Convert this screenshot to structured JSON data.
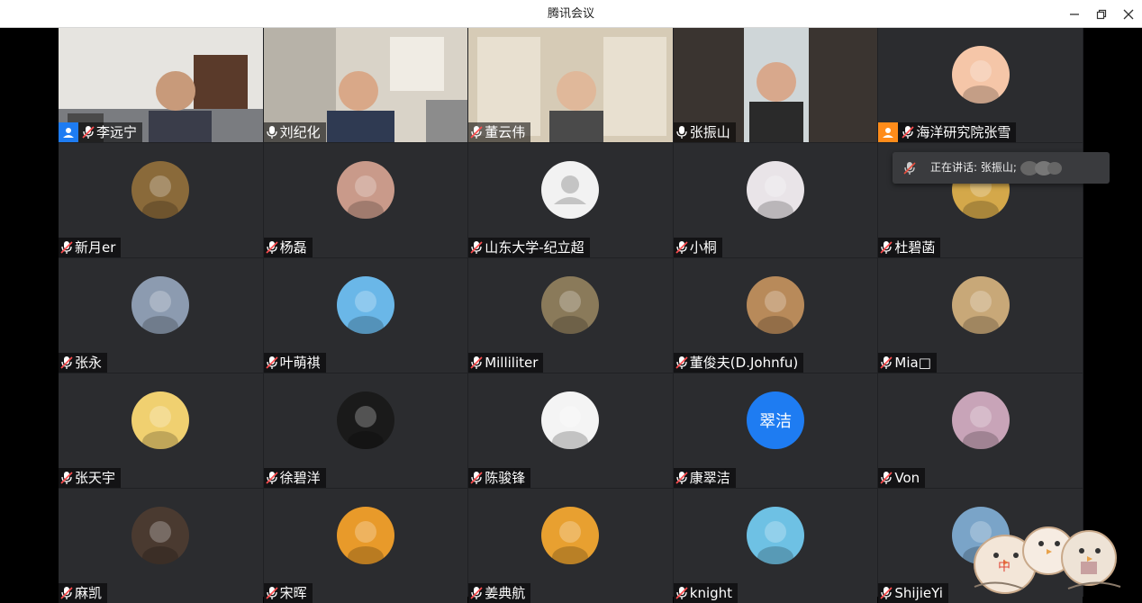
{
  "window": {
    "title": "腾讯会议"
  },
  "participants": [
    {
      "name": "李远宁",
      "mic": "muted",
      "badge": "host",
      "video": true
    },
    {
      "name": "刘纪化",
      "mic": "on",
      "video": true
    },
    {
      "name": "董云伟",
      "mic": "muted",
      "video": true
    },
    {
      "name": "张振山",
      "mic": "on",
      "video": true,
      "speaking": true
    },
    {
      "name": "海洋研究院张雪",
      "mic": "muted",
      "badge": "cohost",
      "video": false
    },
    {
      "name": "新月er",
      "mic": "muted"
    },
    {
      "name": "杨磊",
      "mic": "muted"
    },
    {
      "name": "山东大学-纪立超",
      "mic": "muted",
      "avatar": "default"
    },
    {
      "name": "小桐",
      "mic": "muted"
    },
    {
      "name": "杜碧菡",
      "mic": "muted"
    },
    {
      "name": "张永",
      "mic": "muted"
    },
    {
      "name": "叶萌祺",
      "mic": "muted"
    },
    {
      "name": "Milliliter",
      "mic": "muted"
    },
    {
      "name": "董俊夫(D.Johnfu)",
      "mic": "muted"
    },
    {
      "name": "Mia□",
      "mic": "muted"
    },
    {
      "name": "张天宇",
      "mic": "muted"
    },
    {
      "name": "徐碧洋",
      "mic": "muted"
    },
    {
      "name": "陈骏锋",
      "mic": "muted"
    },
    {
      "name": "康翠洁",
      "mic": "muted",
      "avatar_text": "翠洁"
    },
    {
      "name": "Von",
      "mic": "muted"
    },
    {
      "name": "麻凯",
      "mic": "muted"
    },
    {
      "name": "宋晖",
      "mic": "muted"
    },
    {
      "name": "姜典航",
      "mic": "muted"
    },
    {
      "name": "knight",
      "mic": "muted"
    },
    {
      "name": "ShijieYi",
      "mic": "muted"
    }
  ],
  "speaking_tooltip": {
    "text": "正在讲话: 张振山;"
  },
  "sticker": {
    "label": "中"
  },
  "colors": {
    "accent": "#1e7cf2",
    "speaking": "#27c24c",
    "cohost": "#ff8c1a"
  }
}
